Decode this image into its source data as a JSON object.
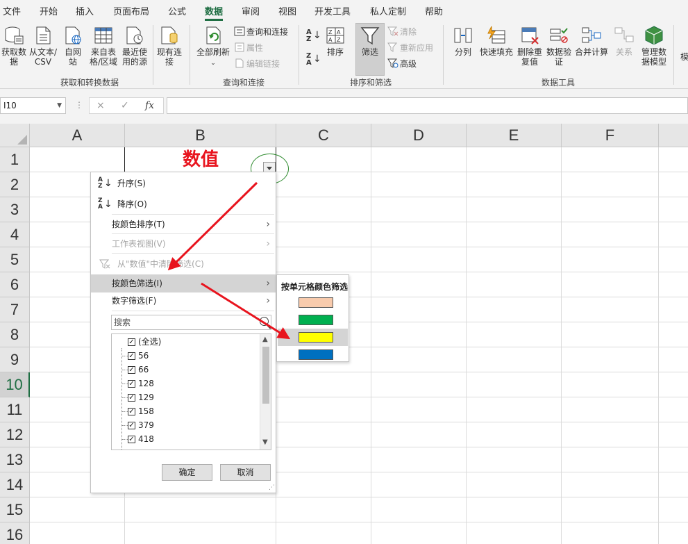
{
  "menu_tabs": [
    "文件",
    "开始",
    "插入",
    "页面布局",
    "公式",
    "数据",
    "审阅",
    "视图",
    "开发工具",
    "私人定制",
    "帮助"
  ],
  "active_tab": "数据",
  "ribbon": {
    "get_data": "获取数据",
    "from_text": "从文本/CSV",
    "from_web": "自网站",
    "from_table": "来自表格/区域",
    "recent_sources": "最近使用的源",
    "existing_conn": "现有连接",
    "group_get_transform": "获取和转换数据",
    "refresh_all": "全部刷新",
    "queries_conn": "查询和连接",
    "properties": "属性",
    "edit_links": "编辑链接",
    "group_queries": "查询和连接",
    "sort_az": "A↓Z",
    "sort": "排序",
    "filter": "筛选",
    "clear": "清除",
    "reapply": "重新应用",
    "advanced": "高级",
    "group_sort_filter": "排序和筛选",
    "text_to_columns": "分列",
    "flash_fill": "快速填充",
    "remove_dup": "删除重复值",
    "data_validation": "数据验证",
    "consolidate": "合并计算",
    "relationships": "关系",
    "manage_model": "管理数据模型",
    "group_data_tools": "数据工具",
    "more": "模"
  },
  "formula_bar": {
    "name_box": "I10",
    "fx": "fx",
    "cancel": "×",
    "enter": "✓",
    "formula": ""
  },
  "columns": [
    "A",
    "B",
    "C",
    "D",
    "E",
    "F"
  ],
  "rows": [
    "1",
    "2",
    "3",
    "4",
    "5",
    "6",
    "7",
    "8",
    "9",
    "10",
    "11",
    "12",
    "13",
    "14",
    "15",
    "16"
  ],
  "selected_row": "10",
  "cell_b1": "数值",
  "filter_menu": {
    "sort_asc": "升序(S)",
    "sort_desc": "降序(O)",
    "sort_by_color": "按颜色排序(T)",
    "sheet_view": "工作表视图(V)",
    "clear_filter": "从\"数值\"中清除筛选(C)",
    "filter_by_color": "按颜色筛选(I)",
    "number_filter": "数字筛选(F)",
    "search_placeholder": "搜索",
    "list": [
      {
        "label": "(全选)",
        "checked": true
      },
      {
        "label": "56",
        "checked": true
      },
      {
        "label": "66",
        "checked": true
      },
      {
        "label": "128",
        "checked": true
      },
      {
        "label": "129",
        "checked": true
      },
      {
        "label": "158",
        "checked": true
      },
      {
        "label": "379",
        "checked": true
      },
      {
        "label": "418",
        "checked": true
      }
    ],
    "ok": "确定",
    "cancel": "取消"
  },
  "color_submenu": {
    "title": "按单元格颜色筛选",
    "swatches": [
      "#f8cbad",
      "#00b050",
      "#ffff00",
      "#0070c0"
    ],
    "highlighted_index": 2
  },
  "colors": {
    "accent_green": "#1f6e43",
    "arrow_red": "#e8141e",
    "circle_green": "#2e8b2e"
  }
}
